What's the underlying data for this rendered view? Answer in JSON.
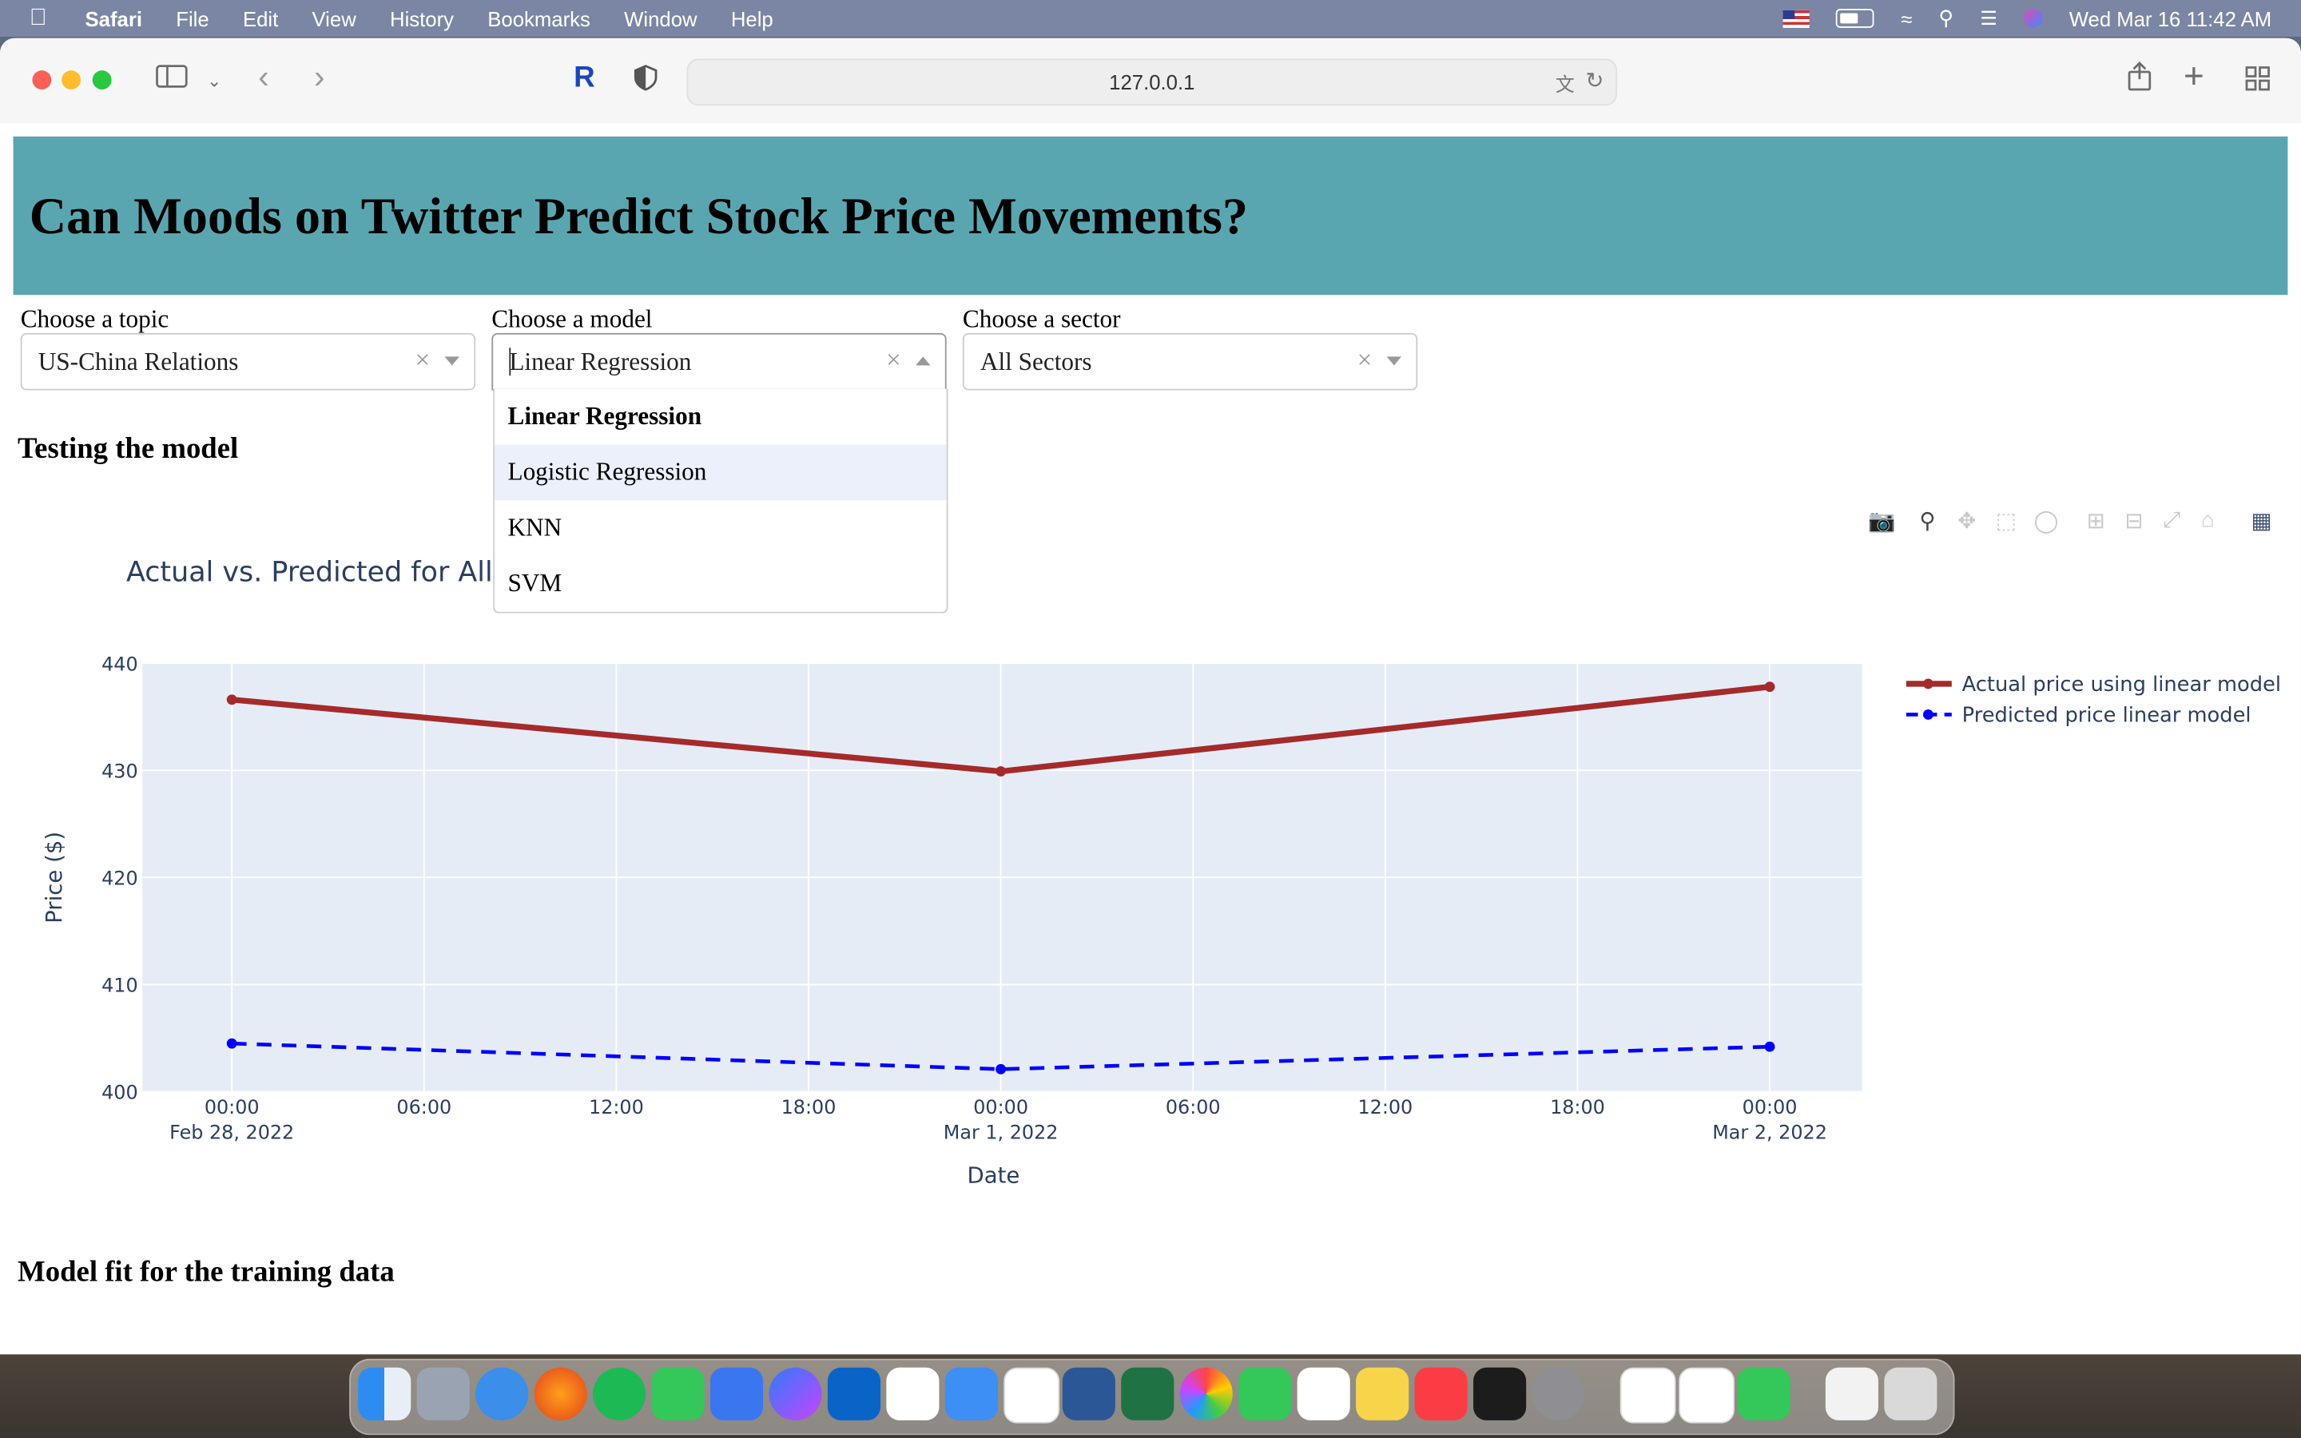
{
  "menubar": {
    "app_name": "Safari",
    "items": [
      "File",
      "Edit",
      "View",
      "History",
      "Bookmarks",
      "Window",
      "Help"
    ],
    "clock": "Wed Mar 16  11:42 AM"
  },
  "browser": {
    "url": "127.0.0.1"
  },
  "page": {
    "title": "Can Moods on Twitter Predict Stock Price Movements?",
    "topic_label": "Choose a topic",
    "topic_value": "US-China Relations",
    "model_label": "Choose a model",
    "model_value": "Linear Regression",
    "model_options": [
      "Linear Regression",
      "Logistic Regression",
      "KNN",
      "SVM"
    ],
    "sector_label": "Choose a sector",
    "sector_value": "All Sectors",
    "section_testing": "Testing the model",
    "section_training": "Model fit for the training data"
  },
  "chart_data": {
    "type": "line",
    "title": "Actual vs. Predicted for All",
    "xlabel": "Date",
    "ylabel": "Price ($)",
    "ylim": [
      400,
      440
    ],
    "y_ticks": [
      400,
      410,
      420,
      430,
      440
    ],
    "x_tick_labels": [
      [
        "00:00",
        "Feb 28, 2022"
      ],
      [
        "06:00",
        ""
      ],
      [
        "12:00",
        ""
      ],
      [
        "18:00",
        ""
      ],
      [
        "00:00",
        "Mar 1, 2022"
      ],
      [
        "06:00",
        ""
      ],
      [
        "12:00",
        ""
      ],
      [
        "18:00",
        ""
      ],
      [
        "00:00",
        "Mar 2, 2022"
      ]
    ],
    "x": [
      "2022-02-28 00:00",
      "2022-03-01 00:00",
      "2022-03-02 00:00"
    ],
    "series": [
      {
        "name": "Actual price using linear model",
        "values": [
          436.6,
          429.9,
          437.8
        ],
        "color": "#a52a2a",
        "dash": "solid"
      },
      {
        "name": "Predicted price linear model",
        "values": [
          404.5,
          402.1,
          404.2
        ],
        "color": "#0000ff",
        "dash": "dash"
      }
    ],
    "legend_position": "top-right",
    "plot_bgcolor": "#e5ecf6",
    "grid": true
  }
}
